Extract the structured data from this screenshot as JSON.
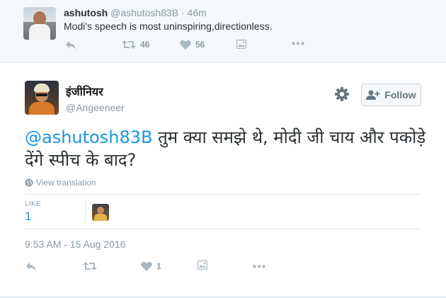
{
  "parent_tweet": {
    "name": "ashutosh",
    "handle": "@ashutosh83B",
    "separator": "·",
    "time": "46m",
    "text": "Modi's speech is most uninspiring,directionless.",
    "retweet_count": "46",
    "like_count": "56",
    "icons": [
      "reply-icon",
      "retweet-icon",
      "heart-icon",
      "photo-icon",
      "more-icon"
    ]
  },
  "main_tweet": {
    "name": "इंजीनियर",
    "handle": "@Angeeneer",
    "follow_label": "Follow",
    "mention": "@ashutosh83B",
    "text_rest": " तुम क्या समझे थे, मोदी जी चाय और पकोड़े देंगे स्पीच के बाद?",
    "translate_label": "View translation",
    "stats_label": "LIKE",
    "stats_value": "1",
    "timestamp": "9:53 AM - 15 Aug 2016",
    "like_count": "1",
    "icons": [
      "globe-icon",
      "gear-icon",
      "follow-person-icon",
      "reply-icon",
      "retweet-icon",
      "heart-icon",
      "photo-icon",
      "more-icon"
    ]
  },
  "colors": {
    "link": "#1b95e0",
    "muted": "#8899a6",
    "icon": "#aab8c2",
    "text": "#292f33",
    "parent_bg": "#f5f8fa",
    "border": "#e1e8ed"
  }
}
